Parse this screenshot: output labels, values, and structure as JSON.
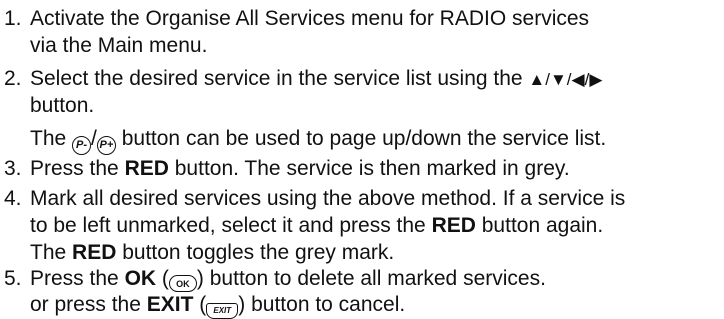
{
  "steps": [
    {
      "num": "1.",
      "lines": [
        "Activate the Organise All Services menu for RADIO services",
        "via the Main menu."
      ]
    },
    {
      "num": "2.",
      "line1_pre": "Select the desired service in the service list using the",
      "arrows": "▲/▼/◀/▶",
      "line2": "button.",
      "line3_pre": "The",
      "page_sep": "/",
      "line3_post": "button can be used to page up/down the service list.",
      "icon_page_down": "P-",
      "icon_page_up": "P+"
    },
    {
      "num": "3.",
      "pre": "Press the",
      "bold": "RED",
      "post": "button. The service is then marked in grey."
    },
    {
      "num": "4.",
      "line1": "Mark all desired services using the above method. If a service is",
      "line2_pre": "to be left unmarked, select it and press the",
      "line2_bold": "RED",
      "line2_post": "button again.",
      "line3_pre": "The",
      "line3_bold": "RED",
      "line3_post": "button toggles the grey mark."
    },
    {
      "num": "5.",
      "line1_pre": "Press the",
      "line1_bold": "OK",
      "line1_open": "(",
      "ok_icon_text": "OK",
      "line1_close": ")",
      "line1_post": "button to delete all marked services.",
      "line2_pre": "or press the",
      "line2_bold": "EXIT",
      "line2_open": "(",
      "exit_icon_text": "EXIT",
      "line2_close": ")",
      "line2_post": "button to cancel."
    }
  ]
}
